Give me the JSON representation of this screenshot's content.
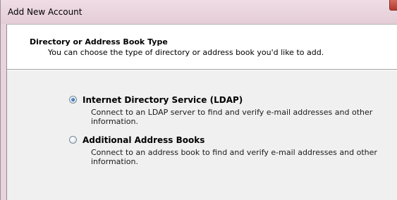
{
  "window": {
    "title": "Add New Account"
  },
  "header": {
    "title": "Directory or Address Book Type",
    "subtitle": "You can choose the type of directory or address book you'd like to add."
  },
  "options": [
    {
      "label": "Internet Directory Service (LDAP)",
      "description": "Connect to an LDAP server to find and verify e-mail addresses and other information.",
      "selected": true
    },
    {
      "label": "Additional Address Books",
      "description": "Connect to an address book to find and verify e-mail addresses and other information.",
      "selected": false
    }
  ],
  "colors": {
    "title_bar": "#e9d3dc",
    "close_button": "#c0463a",
    "radio_dot": "#1f5fa8"
  }
}
